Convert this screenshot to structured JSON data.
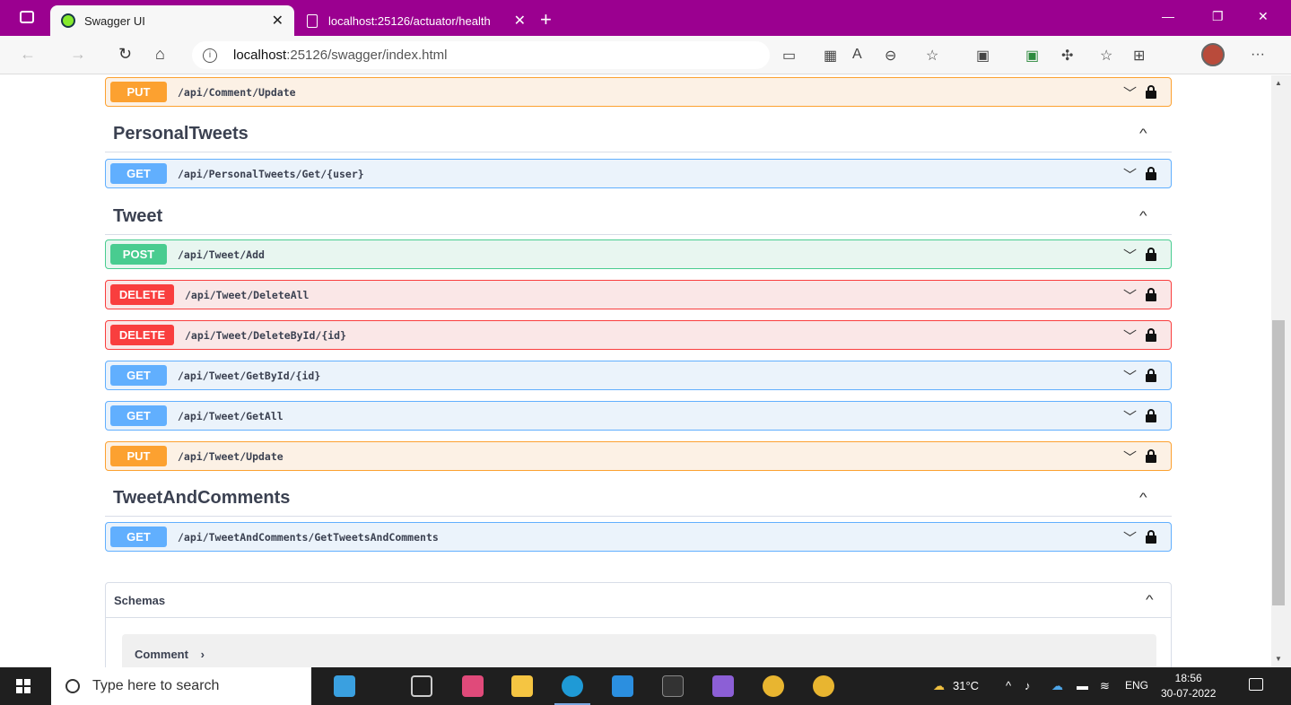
{
  "browser": {
    "tabs": [
      {
        "title": "Swagger UI",
        "active": true
      },
      {
        "title": "localhost:25126/actuator/health",
        "active": false
      }
    ],
    "url_host": "localhost",
    "url_rest": ":25126/swagger/index.html",
    "more_label": "···"
  },
  "operations_top": [
    {
      "method": "PUT",
      "path": "/api/Comment/Update"
    }
  ],
  "tags": [
    {
      "name": "PersonalTweets"
    },
    {
      "name": "Tweet"
    },
    {
      "name": "TweetAndComments"
    }
  ],
  "operations": {
    "personal": [
      {
        "method": "GET",
        "path": "/api/PersonalTweets/Get/{user}"
      }
    ],
    "tweet": [
      {
        "method": "POST",
        "path": "/api/Tweet/Add"
      },
      {
        "method": "DELETE",
        "path": "/api/Tweet/DeleteAll"
      },
      {
        "method": "DELETE",
        "path": "/api/Tweet/DeleteById/{id}"
      },
      {
        "method": "GET",
        "path": "/api/Tweet/GetById/{id}"
      },
      {
        "method": "GET",
        "path": "/api/Tweet/GetAll"
      },
      {
        "method": "PUT",
        "path": "/api/Tweet/Update"
      }
    ],
    "tac": [
      {
        "method": "GET",
        "path": "/api/TweetAndComments/GetTweetsAndComments"
      }
    ]
  },
  "schemas": {
    "title": "Schemas",
    "models": [
      "Comment"
    ]
  },
  "taskbar": {
    "search_placeholder": "Type here to search",
    "temperature": "31°C",
    "language": "ENG",
    "time": "18:56",
    "date": "30-07-2022"
  },
  "colors": {
    "titlebar": "#9b0090",
    "get": "#61affe",
    "post": "#49cc90",
    "put": "#fca130",
    "delete": "#f93e3e"
  }
}
